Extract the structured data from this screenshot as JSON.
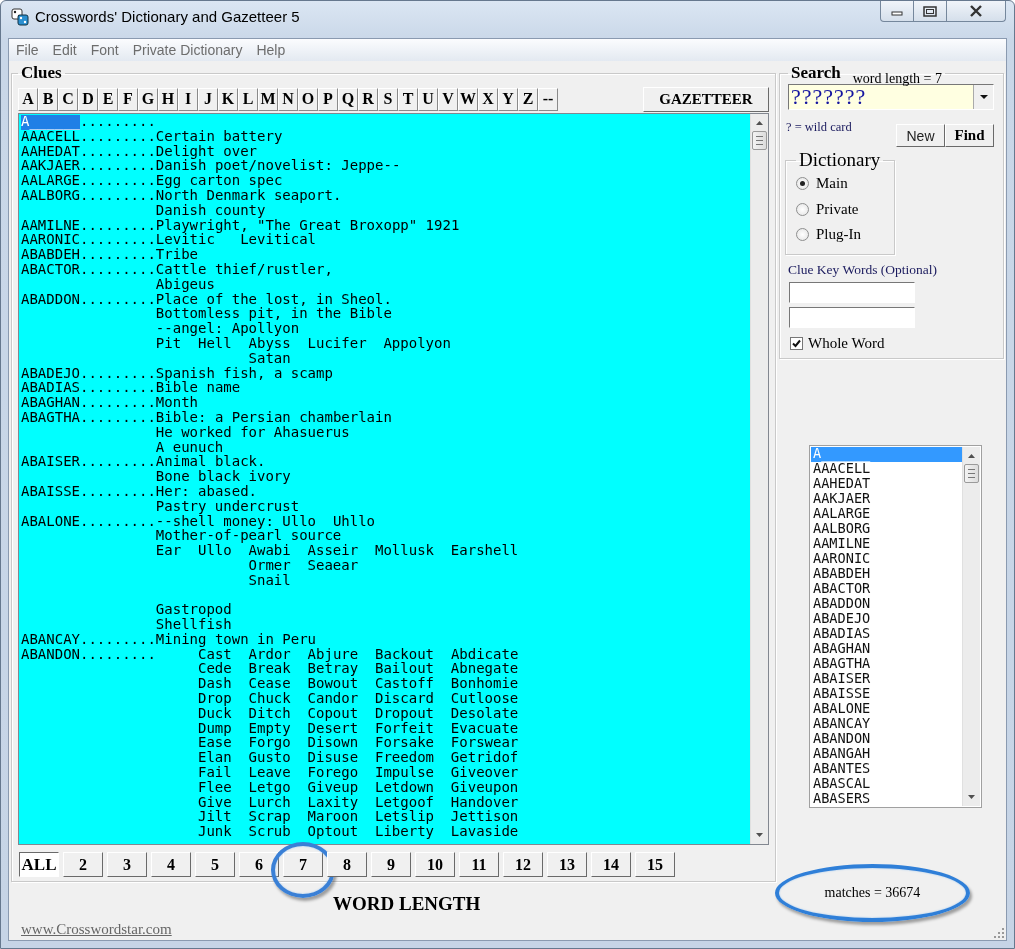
{
  "window": {
    "title": "Crosswords' Dictionary and Gazetteer 5"
  },
  "menu": [
    "File",
    "Edit",
    "Font",
    "Private Dictionary",
    "Help"
  ],
  "clues": {
    "title": "Clues",
    "letters": [
      "A",
      "B",
      "C",
      "D",
      "E",
      "F",
      "G",
      "H",
      "I",
      "J",
      "K",
      "L",
      "M",
      "N",
      "O",
      "P",
      "Q",
      "R",
      "S",
      "T",
      "U",
      "V",
      "W",
      "X",
      "Y",
      "Z",
      "--"
    ],
    "gazetteer_button": "GAZETTEER",
    "lines": [
      {
        "word": "A______",
        "selected": true,
        "text": "........."
      },
      {
        "word": "AAACELL",
        "selected": false,
        "text": ".........Certain battery"
      },
      {
        "word": "AAHEDAT",
        "selected": false,
        "text": ".........Delight over"
      },
      {
        "word": "AAKJAER",
        "selected": false,
        "text": ".........Danish poet/novelist: Jeppe--"
      },
      {
        "word": "AALARGE",
        "selected": false,
        "text": ".........Egg carton spec"
      },
      {
        "word": "AALBORG",
        "selected": false,
        "text": ".........North Denmark seaport."
      },
      {
        "text": "Danish county"
      },
      {
        "word": "AAMILNE",
        "selected": false,
        "text": ".........Playwright, \"The Great Broxopp\" 1921"
      },
      {
        "word": "AARONIC",
        "selected": false,
        "text": ".........Levitic   Levitical"
      },
      {
        "word": "ABABDEH",
        "selected": false,
        "text": ".........Tribe"
      },
      {
        "word": "ABACTOR",
        "selected": false,
        "text": ".........Cattle thief/rustler,"
      },
      {
        "text": "Abigeus"
      },
      {
        "word": "ABADDON",
        "selected": false,
        "text": ".........Place of the lost, in Sheol."
      },
      {
        "text": "Bottomless pit, in the Bible"
      },
      {
        "text": "--angel: Apollyon"
      },
      {
        "text": "Pit  Hell  Abyss  Lucifer  Appolyon"
      },
      {
        "text": "           Satan"
      },
      {
        "word": "ABADEJO",
        "selected": false,
        "text": ".........Spanish fish, a scamp"
      },
      {
        "word": "ABADIAS",
        "selected": false,
        "text": ".........Bible name"
      },
      {
        "word": "ABAGHAN",
        "selected": false,
        "text": ".........Month"
      },
      {
        "word": "ABAGTHA",
        "selected": false,
        "text": ".........Bible: a Persian chamberlain"
      },
      {
        "text": "He worked for Ahasuerus"
      },
      {
        "text": "A eunuch"
      },
      {
        "word": "ABAISER",
        "selected": false,
        "text": ".........Animal black."
      },
      {
        "text": "Bone black ivory"
      },
      {
        "word": "ABAISSE",
        "selected": false,
        "text": ".........Her: abased."
      },
      {
        "text": "Pastry undercrust"
      },
      {
        "word": "ABALONE",
        "selected": false,
        "text": ".........--shell money: Ullo  Uhllo"
      },
      {
        "text": "Mother-of-pearl source"
      },
      {
        "text": "Ear  Ullo  Awabi  Asseir  Mollusk  Earshell"
      },
      {
        "text": "           Ormer  Seaear"
      },
      {
        "text": "           Snail"
      },
      {
        "text": "Gastropod",
        "blank_before": true
      },
      {
        "text": "Shellfish"
      },
      {
        "word": "ABANCAY",
        "selected": false,
        "text": ".........Mining town in Peru"
      },
      {
        "word": "ABANDON",
        "selected": false,
        "text": ".........     Cast  Ardor  Abjure  Backout  Abdicate"
      },
      {
        "text": "     Cede  Break  Betray  Bailout  Abnegate"
      },
      {
        "text": "     Dash  Cease  Bowout  Castoff  Bonhomie"
      },
      {
        "text": "     Drop  Chuck  Candor  Discard  Cutloose"
      },
      {
        "text": "     Duck  Ditch  Copout  Dropout  Desolate"
      },
      {
        "text": "     Dump  Empty  Desert  Forfeit  Evacuate"
      },
      {
        "text": "     Ease  Forgo  Disown  Forsake  Forswear"
      },
      {
        "text": "     Elan  Gusto  Disuse  Freedom  Getridof"
      },
      {
        "text": "     Fail  Leave  Forego  Impulse  Giveover"
      },
      {
        "text": "     Flee  Letgo  Giveup  Letdown  Giveupon"
      },
      {
        "text": "     Give  Lurch  Laxity  Letgoof  Handover"
      },
      {
        "text": "     Jilt  Scrap  Maroon  Letslip  Jettison"
      },
      {
        "text": "     Junk  Scrub  Optout  Liberty  Lavaside"
      }
    ],
    "word_lengths": [
      {
        "label": "ALL",
        "selected": true,
        "circled": false
      },
      {
        "label": "2",
        "selected": false,
        "circled": false
      },
      {
        "label": "3",
        "selected": false,
        "circled": false
      },
      {
        "label": "4",
        "selected": false,
        "circled": false
      },
      {
        "label": "5",
        "selected": false,
        "circled": false
      },
      {
        "label": "6",
        "selected": false,
        "circled": false
      },
      {
        "label": "7",
        "selected": false,
        "circled": true
      },
      {
        "label": "8",
        "selected": false,
        "circled": false
      },
      {
        "label": "9",
        "selected": false,
        "circled": false
      },
      {
        "label": "10",
        "selected": false,
        "circled": false
      },
      {
        "label": "11",
        "selected": false,
        "circled": false
      },
      {
        "label": "12",
        "selected": false,
        "circled": false
      },
      {
        "label": "13",
        "selected": false,
        "circled": false
      },
      {
        "label": "14",
        "selected": false,
        "circled": false
      },
      {
        "label": "15",
        "selected": false,
        "circled": false
      }
    ],
    "word_length_caption": "WORD LENGTH"
  },
  "link": "www.Crosswordstar.com",
  "search": {
    "title": "Search",
    "word_length": "word length =  7",
    "pattern": "???????",
    "wildcard_hint": "? = wild card",
    "buttons": [
      {
        "label": "New",
        "kind": "plain"
      },
      {
        "label": "Find",
        "kind": "default"
      }
    ],
    "dictionary": {
      "title": "Dictionary",
      "options": [
        {
          "label": "Main",
          "selected": true
        },
        {
          "label": "Private",
          "selected": false
        },
        {
          "label": "Plug-In",
          "selected": false
        }
      ]
    },
    "key_words_label": "Clue Key Words (Optional)",
    "whole_word": {
      "label": "Whole Word",
      "checked": true
    }
  },
  "word_list": {
    "items": [
      {
        "label": "A______",
        "selected": true
      },
      {
        "label": "AAACELL",
        "selected": false
      },
      {
        "label": "AAHEDAT",
        "selected": false
      },
      {
        "label": "AAKJAER",
        "selected": false
      },
      {
        "label": "AALARGE",
        "selected": false
      },
      {
        "label": "AALBORG",
        "selected": false
      },
      {
        "label": "AAMILNE",
        "selected": false
      },
      {
        "label": "AARONIC",
        "selected": false
      },
      {
        "label": "ABABDEH",
        "selected": false
      },
      {
        "label": "ABACTOR",
        "selected": false
      },
      {
        "label": "ABADDON",
        "selected": false
      },
      {
        "label": "ABADEJO",
        "selected": false
      },
      {
        "label": "ABADIAS",
        "selected": false
      },
      {
        "label": "ABAGHAN",
        "selected": false
      },
      {
        "label": "ABAGTHA",
        "selected": false
      },
      {
        "label": "ABAISER",
        "selected": false
      },
      {
        "label": "ABAISSE",
        "selected": false
      },
      {
        "label": "ABALONE",
        "selected": false
      },
      {
        "label": "ABANCAY",
        "selected": false
      },
      {
        "label": "ABANDON",
        "selected": false
      },
      {
        "label": "ABANGAH",
        "selected": false
      },
      {
        "label": "ABANTES",
        "selected": false
      },
      {
        "label": "ABASCAL",
        "selected": false
      },
      {
        "label": "ABASERS",
        "selected": false
      }
    ]
  },
  "matches": {
    "text": "matches =  36674",
    "circled": true
  }
}
